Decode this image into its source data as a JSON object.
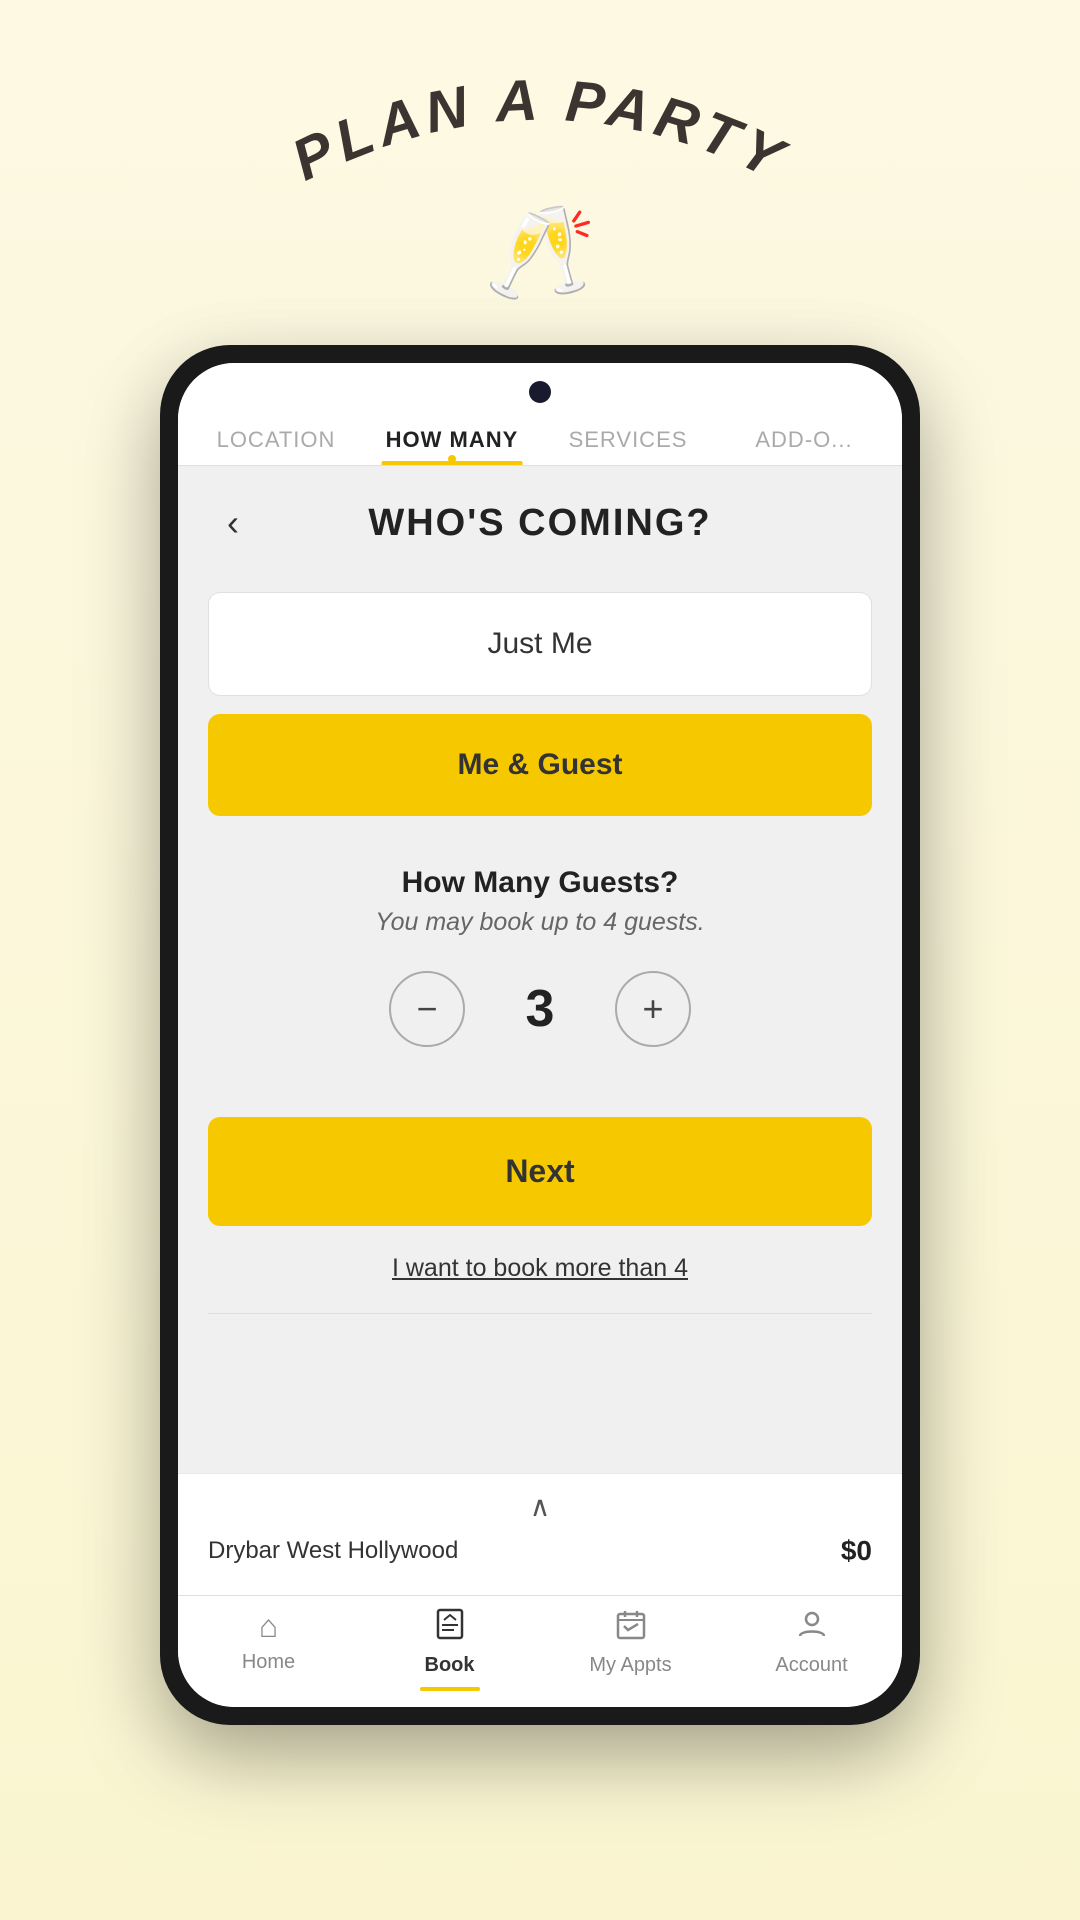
{
  "page": {
    "background_title": "PLAN A PARTY",
    "champagne_emoji": "🥂"
  },
  "tabs": [
    {
      "id": "location",
      "label": "LOCATION",
      "active": false
    },
    {
      "id": "how-many",
      "label": "HOW MANY",
      "active": true
    },
    {
      "id": "services",
      "label": "SERVICES",
      "active": false
    },
    {
      "id": "add-ons",
      "label": "ADD-O...",
      "active": false
    }
  ],
  "header": {
    "back_label": "‹",
    "title": "WHO'S COMING?"
  },
  "options": {
    "just_me_label": "Just Me",
    "me_guest_label": "Me & Guest"
  },
  "guests": {
    "title": "How Many Guests?",
    "subtitle": "You may book up to 4 guests.",
    "count": "3",
    "decrement_icon": "−",
    "increment_icon": "+"
  },
  "next_button": {
    "label": "Next"
  },
  "book_more": {
    "label": "I want to book more than 4"
  },
  "bottom": {
    "chevron": "∧",
    "location": "Drybar West Hollywood",
    "price": "$0"
  },
  "nav": [
    {
      "id": "home",
      "icon": "⌂",
      "label": "Home",
      "active": false
    },
    {
      "id": "book",
      "icon": "📋",
      "label": "Book",
      "active": true
    },
    {
      "id": "my-appts",
      "icon": "📅",
      "label": "My Appts",
      "active": false
    },
    {
      "id": "account",
      "icon": "👤",
      "label": "Account",
      "active": false
    }
  ]
}
